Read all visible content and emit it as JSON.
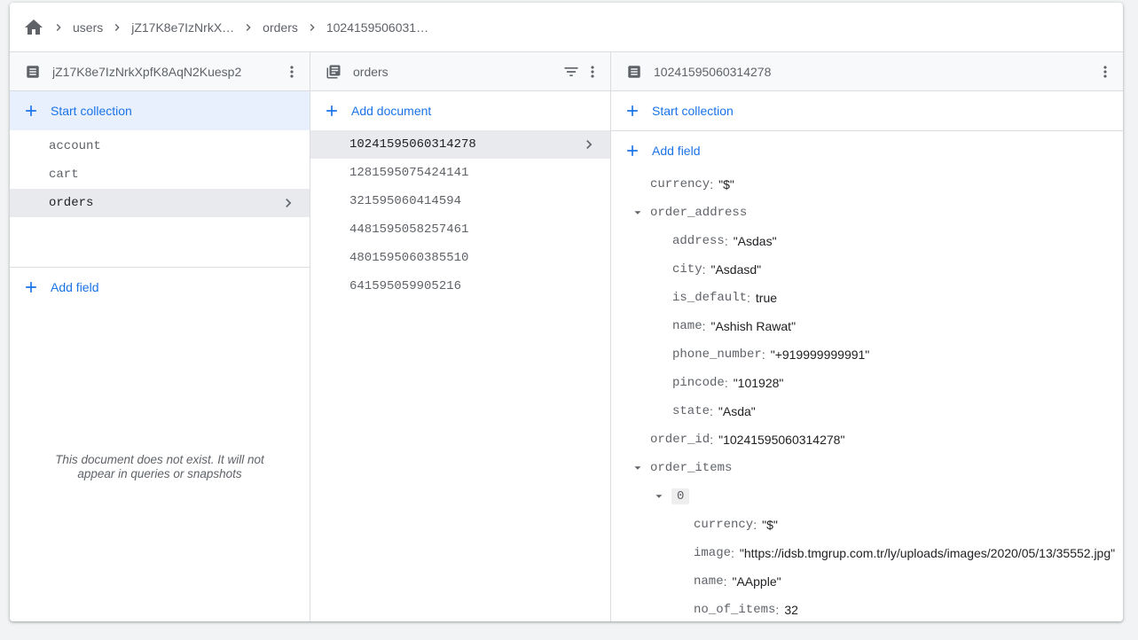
{
  "breadcrumb": {
    "items": [
      "users",
      "jZ17K8e7IzNrkX…",
      "orders",
      "1024159506031…"
    ]
  },
  "column1": {
    "title": "jZ17K8e7IzNrkXpfK8AqN2Kuesp2",
    "start_collection_label": "Start collection",
    "collections": [
      "account",
      "cart",
      "orders"
    ],
    "add_field_label": "Add field",
    "missing_line1": "This document does not exist. It will not",
    "missing_line2": "appear in queries or snapshots"
  },
  "column2": {
    "title": "orders",
    "add_document_label": "Add document",
    "documents": [
      "10241595060314278",
      "1281595075424141",
      "321595060414594",
      "4481595058257461",
      "4801595060385510",
      "641595059905216"
    ]
  },
  "column3": {
    "title": "10241595060314278",
    "start_collection_label": "Start collection",
    "add_field_label": "Add field",
    "fields": {
      "currency": {
        "key": "currency",
        "value": "\"$\""
      },
      "order_address": {
        "key": "order_address",
        "address": {
          "key": "address",
          "value": "\"Asdas\""
        },
        "city": {
          "key": "city",
          "value": "\"Asdasd\""
        },
        "is_default": {
          "key": "is_default",
          "value": "true"
        },
        "name": {
          "key": "name",
          "value": "\"Ashish Rawat\""
        },
        "phone_number": {
          "key": "phone_number",
          "value": "\"+919999999991\""
        },
        "pincode": {
          "key": "pincode",
          "value": "\"101928\""
        },
        "state": {
          "key": "state",
          "value": "\"Asda\""
        }
      },
      "order_id": {
        "key": "order_id",
        "value": "\"10241595060314278\""
      },
      "order_items": {
        "key": "order_items",
        "item0": {
          "index": "0",
          "currency": {
            "key": "currency",
            "value": "\"$\""
          },
          "image": {
            "key": "image",
            "value": "\"https://idsb.tmgrup.com.tr/ly/uploads/images/2020/05/13/35552.jpg\""
          },
          "name": {
            "key": "name",
            "value": "\"AApple\""
          },
          "no_of_items": {
            "key": "no_of_items",
            "value": "32"
          }
        }
      }
    }
  },
  "colors": {
    "accent": "#1a73e8",
    "selected_bg": "#e8f0fe",
    "active_bg": "#e8eaed"
  },
  "icons": [
    "home-icon",
    "chevron-right-icon",
    "document-icon",
    "collection-icon",
    "filter-icon",
    "more-vert-icon",
    "plus-icon",
    "caret-down-icon"
  ]
}
